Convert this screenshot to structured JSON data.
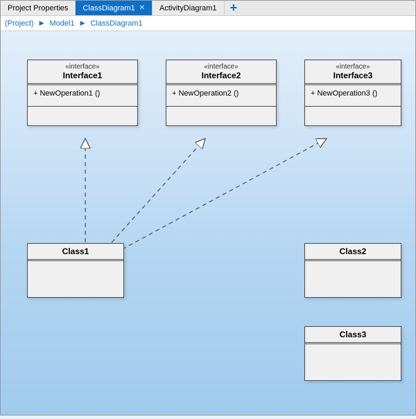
{
  "tabs": {
    "t0": "Project Properties",
    "t1": "ClassDiagram1",
    "t2": "ActivityDiagram1"
  },
  "breadcrumb": {
    "b0": "(Project)",
    "b1": "Model1",
    "b2": "ClassDiagram1"
  },
  "interfaces": {
    "stereo": "«interface»",
    "i1": {
      "name": "Interface1",
      "op": "+ NewOperation1 ()"
    },
    "i2": {
      "name": "Interface2",
      "op": "+ NewOperation2 ()"
    },
    "i3": {
      "name": "Interface3",
      "op": "+ NewOperation3 ()"
    }
  },
  "classes": {
    "c1": "Class1",
    "c2": "Class2",
    "c3": "Class3"
  }
}
